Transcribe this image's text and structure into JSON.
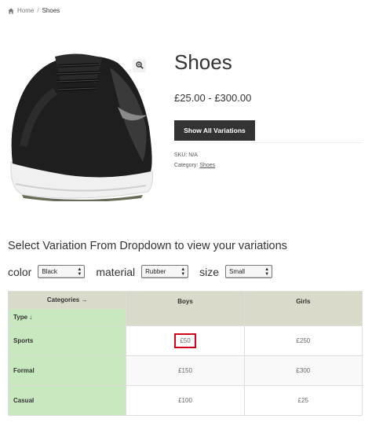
{
  "breadcrumb": {
    "home": "Home",
    "separator": "/",
    "current": "Shoes"
  },
  "product": {
    "title": "Shoes",
    "price": "£25.00 - £300.00",
    "show_button": "Show All Variations",
    "sku_label": "SKU:",
    "sku_value": "N/A",
    "category_label": "Category:",
    "category_value": "Shoes"
  },
  "variation": {
    "heading": "Select Variation From Dropdown to view your variations",
    "filters": [
      {
        "label": "color",
        "value": "Black"
      },
      {
        "label": "material",
        "value": "Rubber"
      },
      {
        "label": "size",
        "value": "Small"
      }
    ]
  },
  "table": {
    "corner_top": "Categories →",
    "corner_bottom": "Type ↓",
    "columns": [
      "Boys",
      "Girls"
    ],
    "rows": [
      {
        "type": "Sports",
        "values": [
          "£50",
          "£250"
        ]
      },
      {
        "type": "Formal",
        "values": [
          "£150",
          "£300"
        ]
      },
      {
        "type": "Casual",
        "values": [
          "£100",
          "£25"
        ]
      }
    ]
  },
  "colors": {
    "header_bg": "#dadacb",
    "type_bg": "#c8e8c0",
    "highlight": "#d0021b",
    "button_bg": "#333333"
  }
}
